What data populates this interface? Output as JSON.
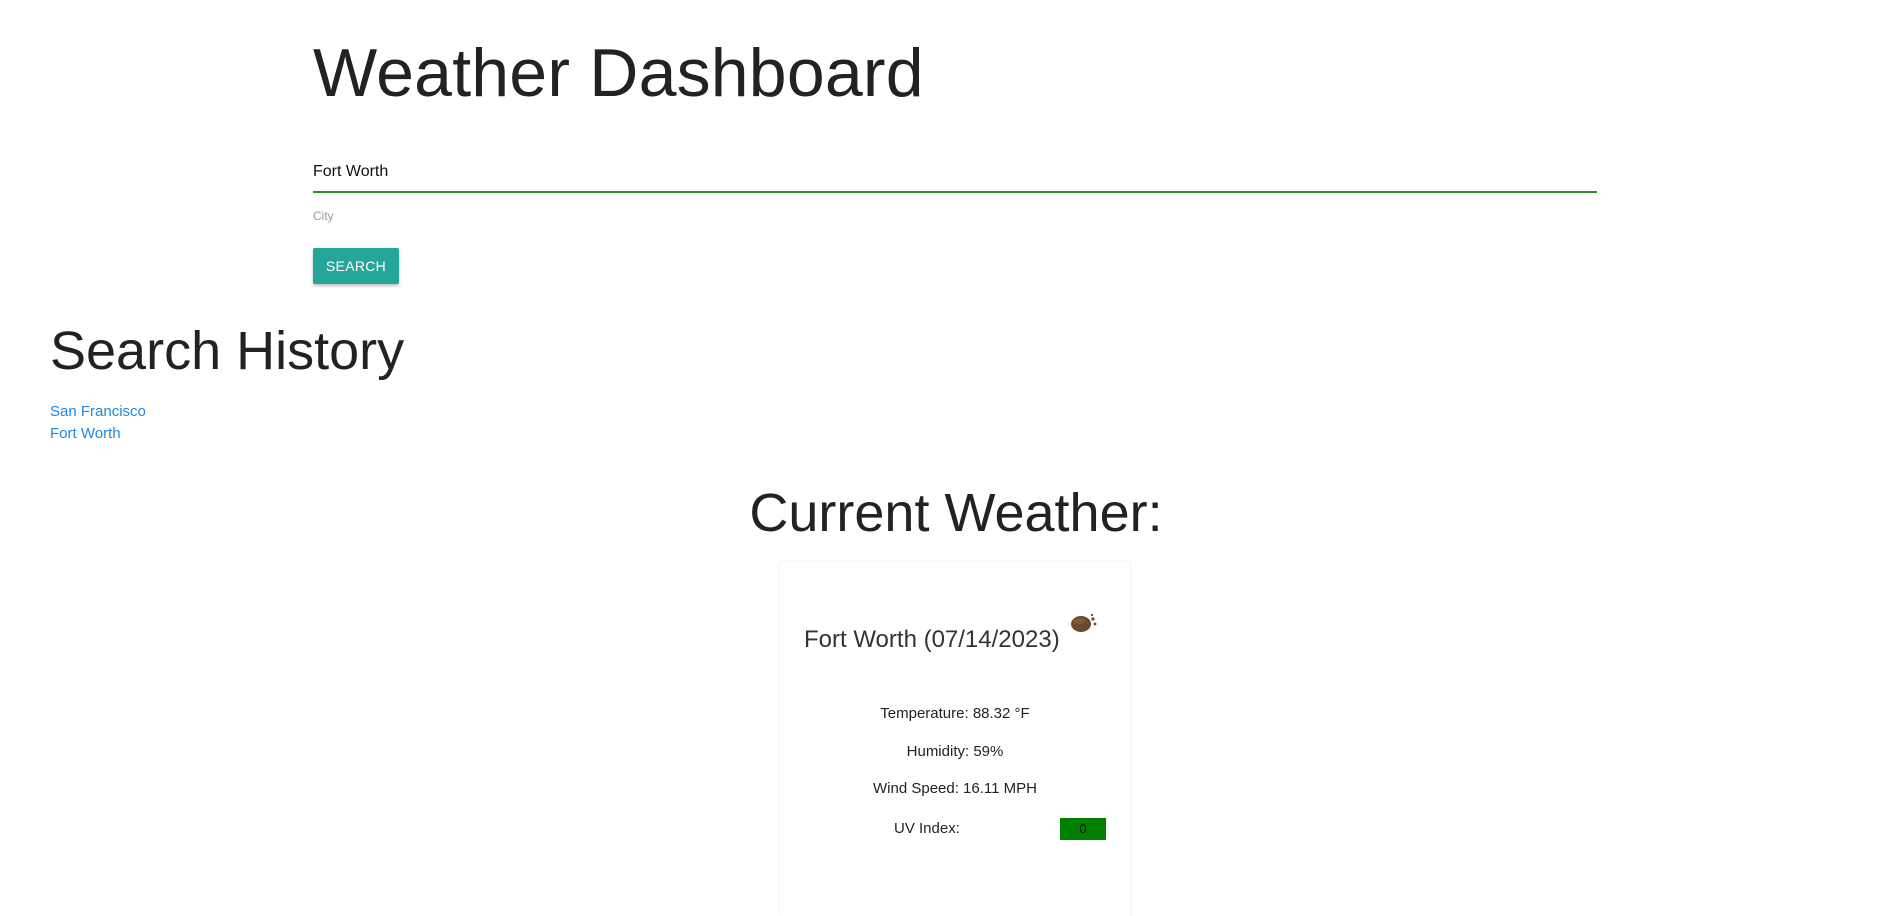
{
  "header": {
    "title": "Weather Dashboard"
  },
  "search": {
    "value": "Fort Worth",
    "label": "City",
    "button_label": "SEARCH"
  },
  "history": {
    "title": "Search History",
    "items": [
      {
        "label": "San Francisco"
      },
      {
        "label": "Fort Worth"
      }
    ]
  },
  "current": {
    "title": "Current Weather:",
    "city_date": "Fort Worth (07/14/2023)",
    "icon": "weather-condition-icon",
    "temperature": "Temperature: 88.32 °F",
    "humidity": "Humidity: 59%",
    "wind": "Wind Speed: 16.11 MPH",
    "uv_label": "UV Index:",
    "uv_value": "0",
    "uv_color": "#008000"
  },
  "colors": {
    "accent": "#26a69a",
    "input_underline": "#2e8b2e",
    "link": "#1e88e5"
  }
}
